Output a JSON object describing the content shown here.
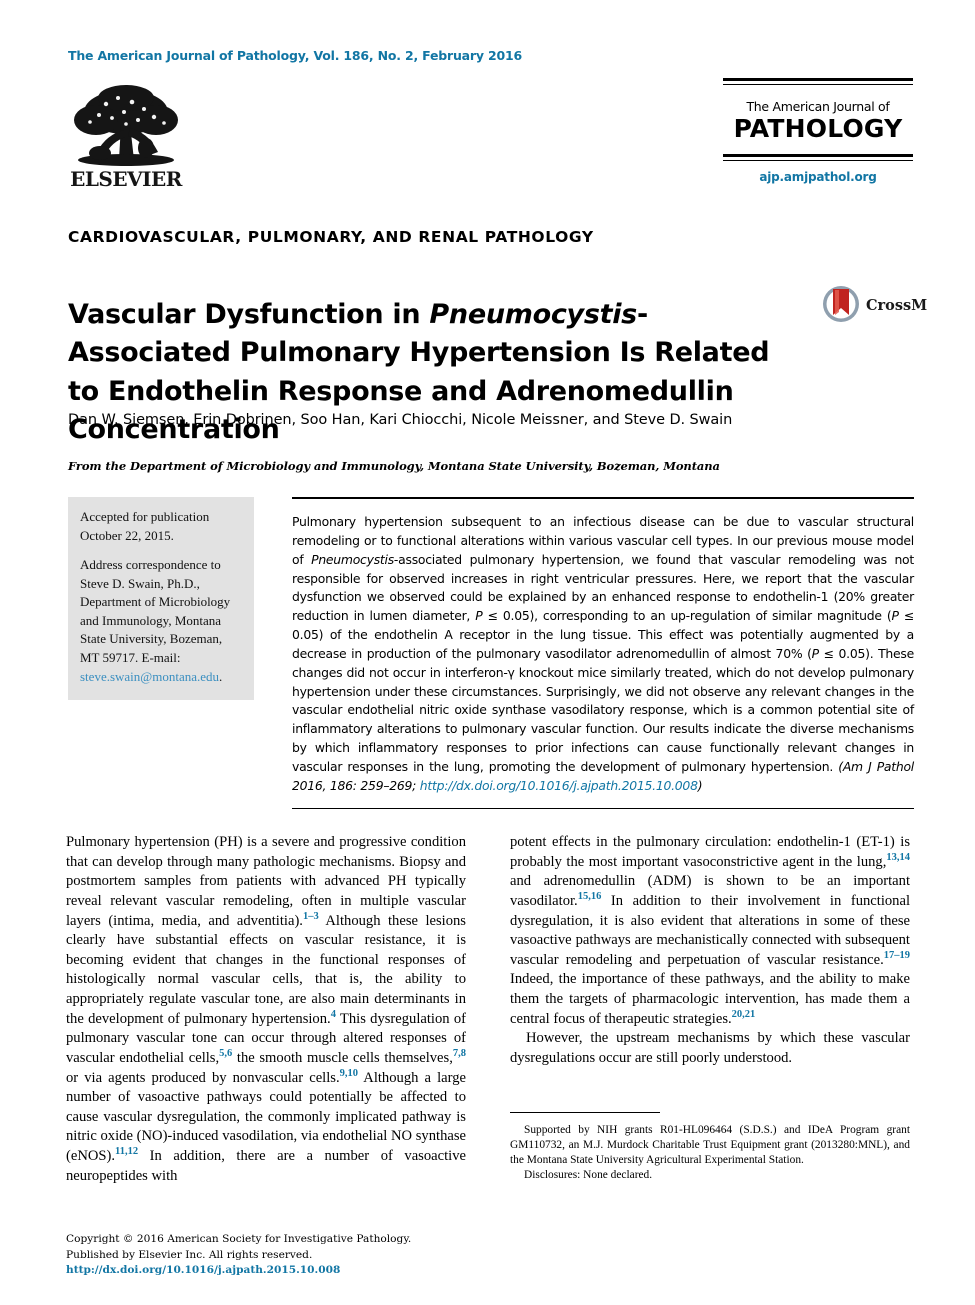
{
  "masthead": {
    "journal_line": "The American Journal of Pathology, Vol. 186, No. 2, February 2016",
    "publisher_name": "ELSEVIER",
    "title_small": "The American Journal of",
    "title_big": "PATHOLOGY",
    "url": "ajp.amjpathol.org",
    "accent_color": "#1276a4"
  },
  "article": {
    "section_heading": "CARDIOVASCULAR, PULMONARY, AND RENAL PATHOLOGY",
    "title_part1": "Vascular Dysfunction in ",
    "title_italic": "Pneumocystis",
    "title_part2": "-Associated Pulmonary Hypertension Is Related to Endothelin Response and Adrenomedullin Concentration",
    "crossmark_label": "CrossMark",
    "authors": "Dan W. Siemsen, Erin Dobrinen, Soo Han, Kari Chiocchi, Nicole Meissner, and Steve D. Swain",
    "affiliation": "From the Department of Microbiology and Immunology, Montana State University, Bozeman, Montana"
  },
  "sidebar": {
    "accepted": "Accepted for publication October 22, 2015.",
    "correspondence_pre": "Address correspondence to Steve D. Swain, Ph.D., Department of Microbiology and Immunology, Montana State University, Bozeman, MT 59717. E-mail: ",
    "correspondence_email": "steve.swain@montana.edu",
    "correspondence_post": "."
  },
  "abstract": {
    "body_1": "Pulmonary hypertension subsequent to an infectious disease can be due to vascular structural remodeling or to functional alterations within various vascular cell types. In our previous mouse model of ",
    "italic_1": "Pneumocystis",
    "body_2": "-associated pulmonary hypertension, we found that vascular remodeling was not responsible for observed increases in right ventricular pressures. Here, we report that the vascular dysfunction we observed could be explained by an enhanced response to endothelin-1 (20% greater reduction in lumen diameter, ",
    "italic_p1": "P",
    "body_3": " ≤ 0.05), corresponding to an up-regulation of similar magnitude (",
    "italic_p2": "P",
    "body_4": " ≤ 0.05) of the endothelin A receptor in the lung tissue. This effect was potentially augmented by a decrease in production of the pulmonary vasodilator adrenomedullin of almost 70% (",
    "italic_p3": "P",
    "body_5": " ≤ 0.05). These changes did not occur in interferon-γ knockout mice similarly treated, which do not develop pulmonary hypertension under these circumstances. Surprisingly, we did not observe any relevant changes in the vascular endothelial nitric oxide synthase vasodilatory response, which is a common potential site of inflammatory alterations to pulmonary vascular function. Our results indicate the diverse mechanisms by which inflammatory responses to prior infections can cause functionally relevant changes in vascular responses in the lung, promoting the development of pulmonary hypertension. ",
    "citation": "(Am J Pathol 2016, 186: 259–269; ",
    "doi_link": "http://dx.doi.org/10.1016/j.ajpath.2015.10.008",
    "citation_close": ")"
  },
  "body": {
    "left_column": [
      {
        "segments": [
          {
            "text": "Pulmonary hypertension (PH) is a severe and progressive condition that can develop through many pathologic mechanisms. Biopsy and postmortem samples from patients with advanced PH typically reveal relevant vascular remodeling, often in multiple vascular layers (intima, media, and adventitia)."
          },
          {
            "ref": "1–3"
          },
          {
            "text": " Although these lesions clearly have substantial effects on vascular resistance, it is becoming evident that changes in the functional responses of histologically normal vascular cells, that is, the ability to appropriately regulate vascular tone, are also main determinants in the development of pulmonary hypertension."
          },
          {
            "ref": "4"
          },
          {
            "text": " This dysregulation of pulmonary vascular tone can occur through altered responses of vascular endothelial cells,"
          },
          {
            "ref": "5,6"
          },
          {
            "text": " the smooth muscle cells themselves,"
          },
          {
            "ref": "7,8"
          },
          {
            "text": " or via agents produced by nonvascular cells."
          },
          {
            "ref": "9,10"
          },
          {
            "text": " Although a large number of vasoactive pathways could potentially be affected to cause vascular dysregulation, the commonly implicated pathway is nitric oxide (NO)-induced vasodilation, via endothelial NO synthase (eNOS)."
          },
          {
            "ref": "11,12"
          },
          {
            "text": " In addition, there are a number of vasoactive neuropeptides with"
          }
        ]
      }
    ],
    "right_column": [
      {
        "segments": [
          {
            "text": "potent effects in the pulmonary circulation: endothelin-1 (ET-1) is probably the most important vasoconstrictive agent in the lung,"
          },
          {
            "ref": "13,14"
          },
          {
            "text": " and adrenomedullin (ADM) is shown to be an important vasodilator."
          },
          {
            "ref": "15,16"
          },
          {
            "text": " In addition to their involvement in functional dysregulation, it is also evident that alterations in some of these vasoactive pathways are mechanistically connected with subsequent vascular remodeling and perpetuation of vascular resistance."
          },
          {
            "ref": "17–19"
          },
          {
            "text": " Indeed, the importance of these pathways, and the ability to make them the targets of pharmacologic intervention, has made them a central focus of therapeutic strategies."
          },
          {
            "ref": "20,21"
          }
        ]
      },
      {
        "segments": [
          {
            "text": "However, the upstream mechanisms by which these vascular dysregulations occur are still poorly understood."
          }
        ]
      }
    ]
  },
  "footnote": {
    "supported_by": "Supported by NIH grants R01-HL096464 (S.D.S.) and IDeA Program grant GM110732, an M.J. Murdock Charitable Trust Equipment grant (2013280:MNL), and the Montana State University Agricultural Experimental Station.",
    "disclosures": "Disclosures: None declared."
  },
  "footer": {
    "copyright_line1": "Copyright © 2016 American Society for Investigative Pathology.",
    "copyright_line2": "Published by Elsevier Inc. All rights reserved.",
    "doi": "http://dx.doi.org/10.1016/j.ajpath.2015.10.008"
  }
}
